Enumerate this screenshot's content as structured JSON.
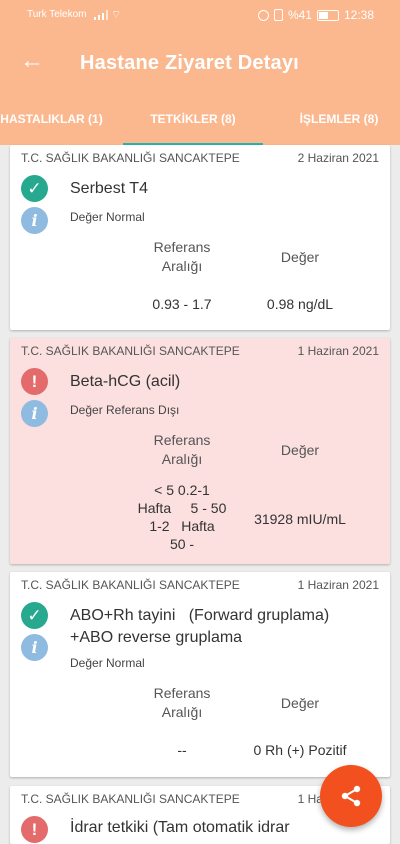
{
  "status_bar": {
    "carrier": "Turk Telekom",
    "battery": "%41",
    "time": "12:38"
  },
  "toolbar": {
    "title": "Hastane Ziyaret Detayı",
    "back_icon": "arrow-left-icon"
  },
  "tabs": [
    {
      "label": "HASTALIKLAR (1)",
      "selected": false
    },
    {
      "label": "TETKİKLER (8)",
      "selected": true
    },
    {
      "label": "İŞLEMLER (8)",
      "selected": false
    }
  ],
  "colors": {
    "app_bar": "#fbb88f",
    "tab_indicator": "#26b3b0",
    "normal_status": "#27a98f",
    "alert_status": "#e36b6b",
    "alert_card": "#fcdfdf",
    "info_icon": "#8fbbe0",
    "fab": "#f2501e"
  },
  "columns": {
    "reference_line1": "Referans",
    "reference_line2": "Aralığı",
    "value": "Değer"
  },
  "tests": [
    {
      "institution": "T.C. SAĞLIK BAKANLIĞI SANCAKTEPE",
      "date": "2 Haziran 2021",
      "status_icon": "check-icon",
      "name_line1": "Serbest T4",
      "name_line2": "",
      "note": "Değer Normal",
      "reference_lines": [
        "0.93 - 1.7"
      ],
      "value": "0.98 ng/dL"
    },
    {
      "institution": "T.C. SAĞLIK BAKANLIĞI SANCAKTEPE",
      "date": "1 Haziran 2021",
      "status_icon": "warning-icon",
      "name_line1": "Beta-hCG (acil)",
      "name_line2": "",
      "note": "Değer Referans Dışı",
      "reference_lines": [
        "< 5 0.2-1",
        "Hafta     5 - 50",
        "1-2   Hafta",
        "50 -"
      ],
      "value": "31928 mIU/mL"
    },
    {
      "institution": "T.C. SAĞLIK BAKANLIĞI SANCAKTEPE",
      "date": "1 Haziran 2021",
      "status_icon": "check-icon",
      "name_line1": "ABO+Rh tayini   (Forward gruplama)",
      "name_line2": "+ABO reverse gruplama",
      "note": "Değer Normal",
      "reference_lines": [
        "--"
      ],
      "value": "0 Rh (+) Pozitif"
    },
    {
      "institution": "T.C. SAĞLIK BAKANLIĞI SANCAKTEPE",
      "date": "1 Haziran 2021",
      "status_icon": "warning-icon",
      "name_line1": "İdrar tetkiki (Tam otomatik idrar",
      "name_line2": "",
      "note": "",
      "reference_lines": [],
      "value": ""
    }
  ],
  "fab": {
    "icon": "share-icon"
  }
}
